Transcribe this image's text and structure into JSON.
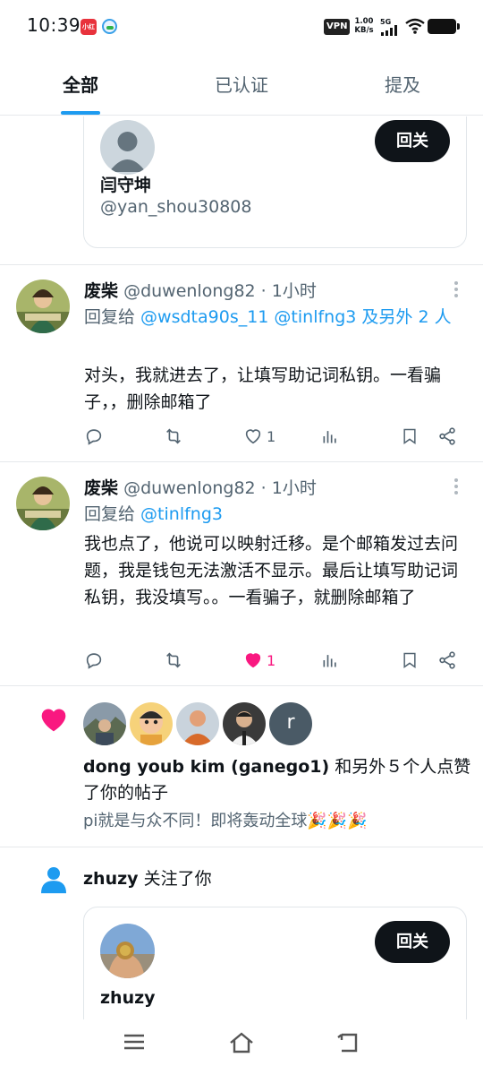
{
  "status": {
    "time": "10:39",
    "app1_label": "小红书",
    "vpn": "VPN",
    "speed_value": "1.00",
    "speed_unit": "KB/s",
    "network": "5G"
  },
  "tabs": [
    {
      "label": "全部",
      "active": true
    },
    {
      "label": "已认证"
    },
    {
      "label": "提及"
    }
  ],
  "card_top": {
    "name": "闫守坤",
    "handle": "@yan_shou30808",
    "button": "回关"
  },
  "tweets": [
    {
      "name": "废柴",
      "meta": "@duwenlong82 · 1小时",
      "reply_prefix": "回复给 ",
      "reply_mentions": "@wsdta90s_11 @tinlfng3 及另外 2 人",
      "body": "对头，我就进去了，让填写助记词私钥。一看骗子，，删除邮箱了",
      "likes": "1",
      "liked": false
    },
    {
      "name": "废柴",
      "meta": "@duwenlong82 · 1小时",
      "reply_prefix": "回复给 ",
      "reply_mentions": "@tinlfng3",
      "body": "我也点了，他说可以映射迁移。是个邮箱发过去问题，我是钱包无法激活不显示。最后让填写助记词私钥，我没填写。。一看骗子，就删除邮箱了",
      "likes": "1",
      "liked": true
    }
  ],
  "like_notification": {
    "avatar_letter": "r",
    "actor": "dong youb kim (ganego1)",
    "action": " 和另外５个人点赞了你的帖子",
    "post": "pi就是与众不同！即将轰动全球🎉🎉🎉"
  },
  "follow_notification": {
    "actor": "zhuzy",
    "action": " 关注了你",
    "card_name": "zhuzy",
    "button": "回关"
  },
  "colors": {
    "accent": "#1d9bf0",
    "like": "#f91880",
    "text": "#0f1419",
    "secondary": "#536471"
  },
  "icons": [
    "reply-icon",
    "retweet-icon",
    "heart-icon",
    "views-icon",
    "bookmark-icon",
    "share-icon",
    "person-icon",
    "menu-icon",
    "home-icon",
    "back-icon"
  ]
}
